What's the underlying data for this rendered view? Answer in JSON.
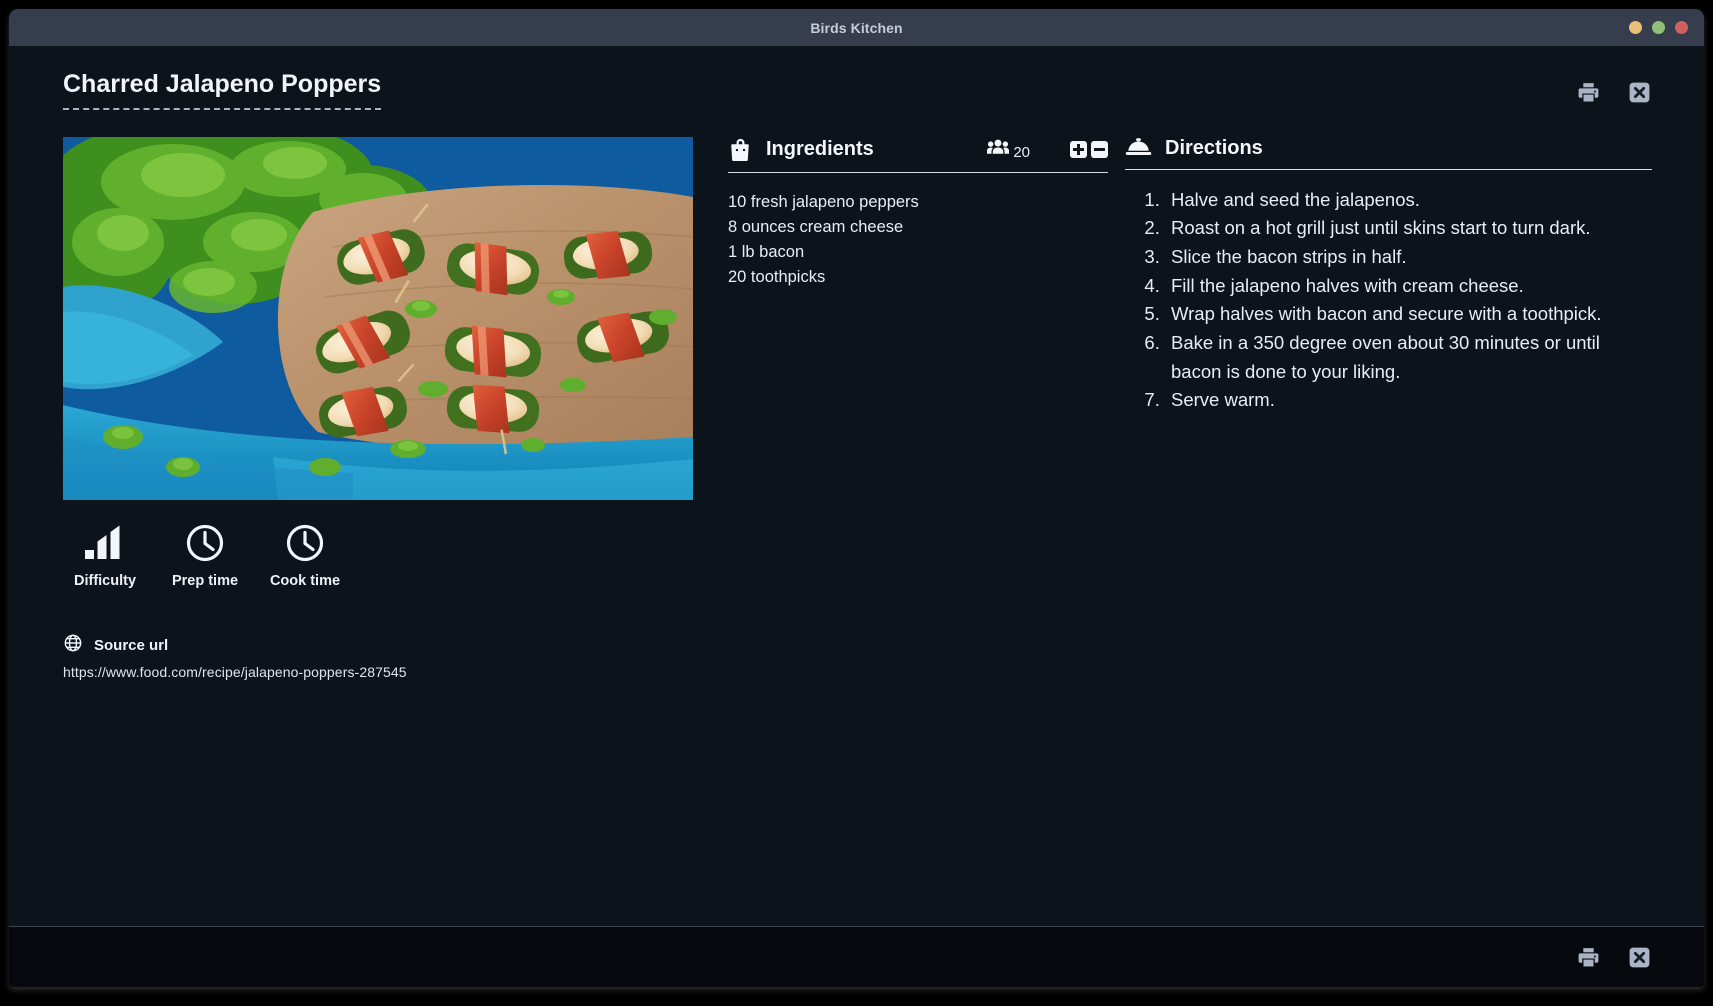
{
  "window": {
    "title": "Birds Kitchen",
    "controls": [
      {
        "name": "minimize",
        "color": "#e9c178"
      },
      {
        "name": "maximize",
        "color": "#8fc07a"
      },
      {
        "name": "close",
        "color": "#cf6060"
      }
    ]
  },
  "header": {
    "recipe_title": "Charred Jalapeno Poppers",
    "actions": [
      {
        "name": "print",
        "icon": "printer-icon"
      },
      {
        "name": "close",
        "icon": "close-box-icon"
      }
    ]
  },
  "photo": {
    "alt": "Bacon wrapped jalapeno poppers on a wooden board with parsley and blue cloth"
  },
  "meta": {
    "items": [
      {
        "icon": "signal-bars-icon",
        "label": "Difficulty",
        "value": ""
      },
      {
        "icon": "clock-icon",
        "label": "Prep time",
        "value": ""
      },
      {
        "icon": "clock-icon",
        "label": "Cook time",
        "value": ""
      }
    ]
  },
  "source": {
    "icon": "globe-icon",
    "label": "Source url",
    "url": "https://www.food.com/recipe/jalapeno-poppers-287545"
  },
  "ingredients": {
    "icon": "shopping-bag-icon",
    "title": "Ingredients",
    "servings_icon": "users-icon",
    "servings": "20",
    "increase_label": "+",
    "decrease_label": "−",
    "items": [
      "10 fresh jalapeno peppers",
      "8 ounces cream cheese",
      "1 lb bacon",
      "20 toothpicks"
    ]
  },
  "directions": {
    "icon": "serving-dome-icon",
    "title": "Directions",
    "steps": [
      "Halve and seed the jalapenos.",
      "Roast on a hot grill just until skins start to turn dark.",
      "Slice the bacon strips in half.",
      "Fill the jalapeno halves with cream cheese.",
      "Wrap halves with bacon and secure with a toothpick.",
      "Bake in a 350 degree oven about 30 minutes or until bacon is done to your liking.",
      "Serve warm."
    ]
  },
  "footer": {
    "actions": [
      {
        "name": "print",
        "icon": "printer-icon"
      },
      {
        "name": "close",
        "icon": "close-box-icon"
      }
    ]
  },
  "colors": {
    "window_bg": "#0d131b",
    "titlebar_bg": "#363d4d",
    "footer_bg": "#060a0e",
    "text_primary": "#e9edf3",
    "icon_muted": "#aab4c4"
  }
}
